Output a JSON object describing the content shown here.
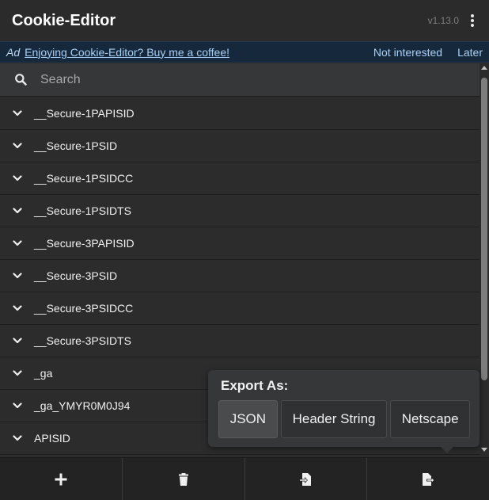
{
  "header": {
    "title": "Cookie-Editor",
    "version": "v1.13.0",
    "menu_icon": "kebab-menu-icon"
  },
  "ad": {
    "tag": "Ad",
    "text": "Enjoying Cookie-Editor? Buy me a coffee!",
    "not_interested": "Not interested",
    "later": "Later"
  },
  "search": {
    "placeholder": "Search",
    "value": "",
    "icon": "search-icon"
  },
  "cookies": [
    {
      "name": "__Secure-1PAPISID"
    },
    {
      "name": "__Secure-1PSID"
    },
    {
      "name": "__Secure-1PSIDCC"
    },
    {
      "name": "__Secure-1PSIDTS"
    },
    {
      "name": "__Secure-3PAPISID"
    },
    {
      "name": "__Secure-3PSID"
    },
    {
      "name": "__Secure-3PSIDCC"
    },
    {
      "name": "__Secure-3PSIDTS"
    },
    {
      "name": "_ga"
    },
    {
      "name": "_ga_YMYR0M0J94"
    },
    {
      "name": "APISID"
    }
  ],
  "export_popup": {
    "title": "Export As:",
    "options": [
      "JSON",
      "Header String",
      "Netscape"
    ],
    "active": "JSON"
  },
  "footer": {
    "buttons": [
      "add-icon",
      "delete-icon",
      "import-icon",
      "export-icon"
    ]
  },
  "colors": {
    "background": "#2b2b2b",
    "ad_background": "#16283b",
    "ad_link": "#a8d0f5"
  }
}
